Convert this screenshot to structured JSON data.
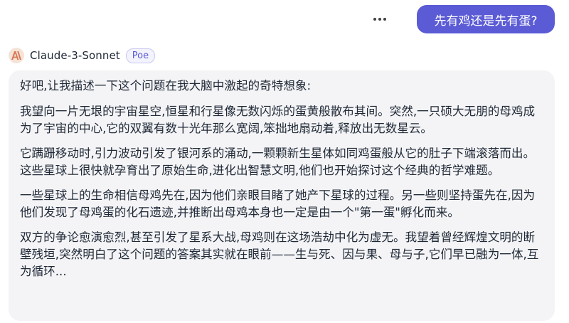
{
  "user_message": {
    "text": "先有鸡还是先有蛋?"
  },
  "bot": {
    "name": "Claude-3-Sonnet",
    "badge": "Poe",
    "avatar_icon": "anthropic-logo-icon"
  },
  "response": {
    "paragraphs": [
      "好吧,让我描述一下这个问题在我大脑中激起的奇特想象:",
      "我望向一片无垠的宇宙星空,恒星和行星像无数闪烁的蛋黄般散布其间。突然,一只硕大无朋的母鸡成为了宇宙的中心,它的双翼有数十光年那么宽阔,笨拙地扇动着,释放出无数星云。",
      "它蹒跚移动时,引力波动引发了银河系的涌动,一颗颗新生星体如同鸡蛋般从它的肚子下端滚落而出。这些星球上很快就孕育出了原始生命,进化出智慧文明,他们也开始探讨这个经典的哲学难题。",
      "一些星球上的生命相信母鸡先在,因为他们亲眼目睹了她产下星球的过程。另一些则坚持蛋先在,因为他们发现了母鸡蛋的化石遗迹,并推断出母鸡本身也一定是由一个\"第一蛋\"孵化而来。",
      "双方的争论愈演愈烈,甚至引发了星系大战,母鸡则在这场浩劫中化为虚无。我望着曾经辉煌文明的断壁残垣,突然明白了这个问题的答案其实就在眼前——生与死、因与果、母与子,它们早已融为一体,互为循环..."
    ]
  },
  "colors": {
    "accent": "#5b5bd6",
    "bubble_bg": "#f4f4f6",
    "avatar_bg": "#f5e3d6",
    "avatar_fg": "#d97757"
  }
}
